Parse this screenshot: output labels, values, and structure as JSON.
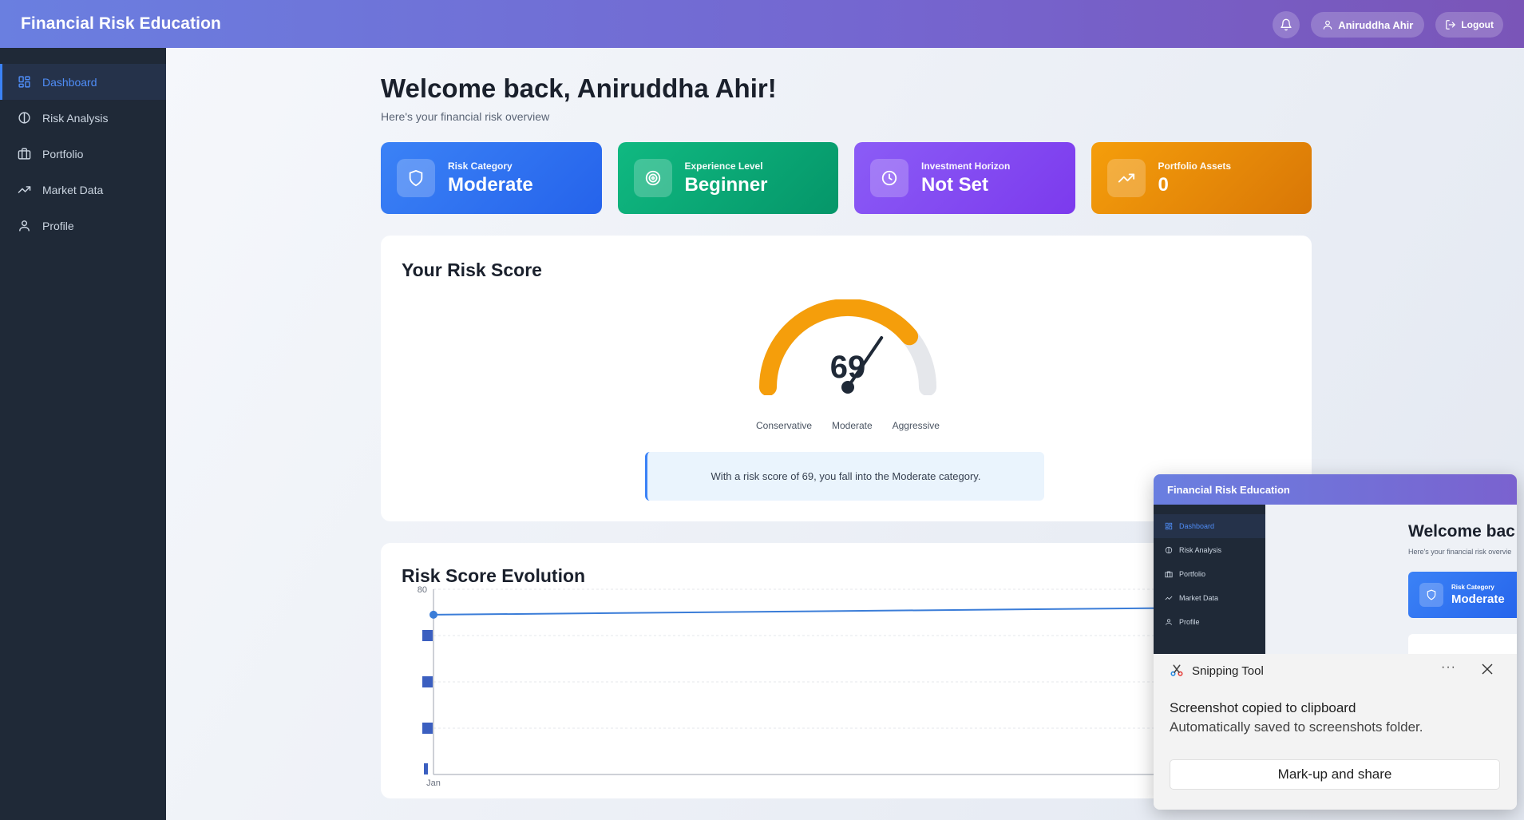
{
  "app": {
    "title": "Financial Risk Education"
  },
  "header": {
    "notification_icon": "bell-icon",
    "user_name": "Aniruddha Ahir",
    "logout_label": "Logout"
  },
  "sidebar": {
    "items": [
      {
        "label": "Dashboard",
        "icon": "grid-icon",
        "active": true
      },
      {
        "label": "Risk Analysis",
        "icon": "circle-split-icon",
        "active": false
      },
      {
        "label": "Portfolio",
        "icon": "briefcase-icon",
        "active": false
      },
      {
        "label": "Market Data",
        "icon": "trending-up-icon",
        "active": false
      },
      {
        "label": "Profile",
        "icon": "user-icon",
        "active": false
      }
    ]
  },
  "main": {
    "welcome": "Welcome back, Aniruddha Ahir!",
    "subtitle": "Here's your financial risk overview",
    "cards": [
      {
        "label": "Risk Category",
        "value": "Moderate",
        "icon": "shield-icon",
        "color": "#2f6ff5"
      },
      {
        "label": "Experience Level",
        "value": "Beginner",
        "icon": "target-icon",
        "color": "#0fa57a"
      },
      {
        "label": "Investment Horizon",
        "value": "Not Set",
        "icon": "clock-icon",
        "color": "#8048f0"
      },
      {
        "label": "Portfolio Assets",
        "value": "0",
        "icon": "trending-up-icon",
        "color": "#ea8b0c"
      }
    ],
    "risk_score": {
      "title": "Your Risk Score",
      "score": "69",
      "score_fraction": 0.69,
      "labels": [
        "Conservative",
        "Moderate",
        "Aggressive"
      ],
      "message": "With a risk score of 69, you fall into the Moderate category.",
      "gauge_color": "#f59e0b",
      "track_color": "#e5e7eb"
    },
    "evolution": {
      "title": "Risk Score Evolution"
    }
  },
  "chart_data": {
    "type": "line",
    "title": "Risk Score Evolution",
    "x": [
      "Jan"
    ],
    "series": [
      {
        "values": [
          69
        ]
      }
    ],
    "ylim": [
      0,
      80
    ],
    "yticks_visible": [
      "80"
    ],
    "grid": true,
    "line_color": "#3b7dd8"
  },
  "snipping_tool": {
    "app_name": "Snipping Tool",
    "message": "Screenshot copied to clipboard",
    "sub_message": "Automatically saved to screenshots folder.",
    "button_label": "Mark-up and share",
    "preview": {
      "title": "Financial Risk Education",
      "nav": [
        "Dashboard",
        "Risk Analysis",
        "Portfolio",
        "Market Data",
        "Profile"
      ],
      "welcome": "Welcome bac",
      "subtitle": "Here's your financial risk overvie",
      "card_label": "Risk Category",
      "card_value": "Moderate"
    }
  }
}
